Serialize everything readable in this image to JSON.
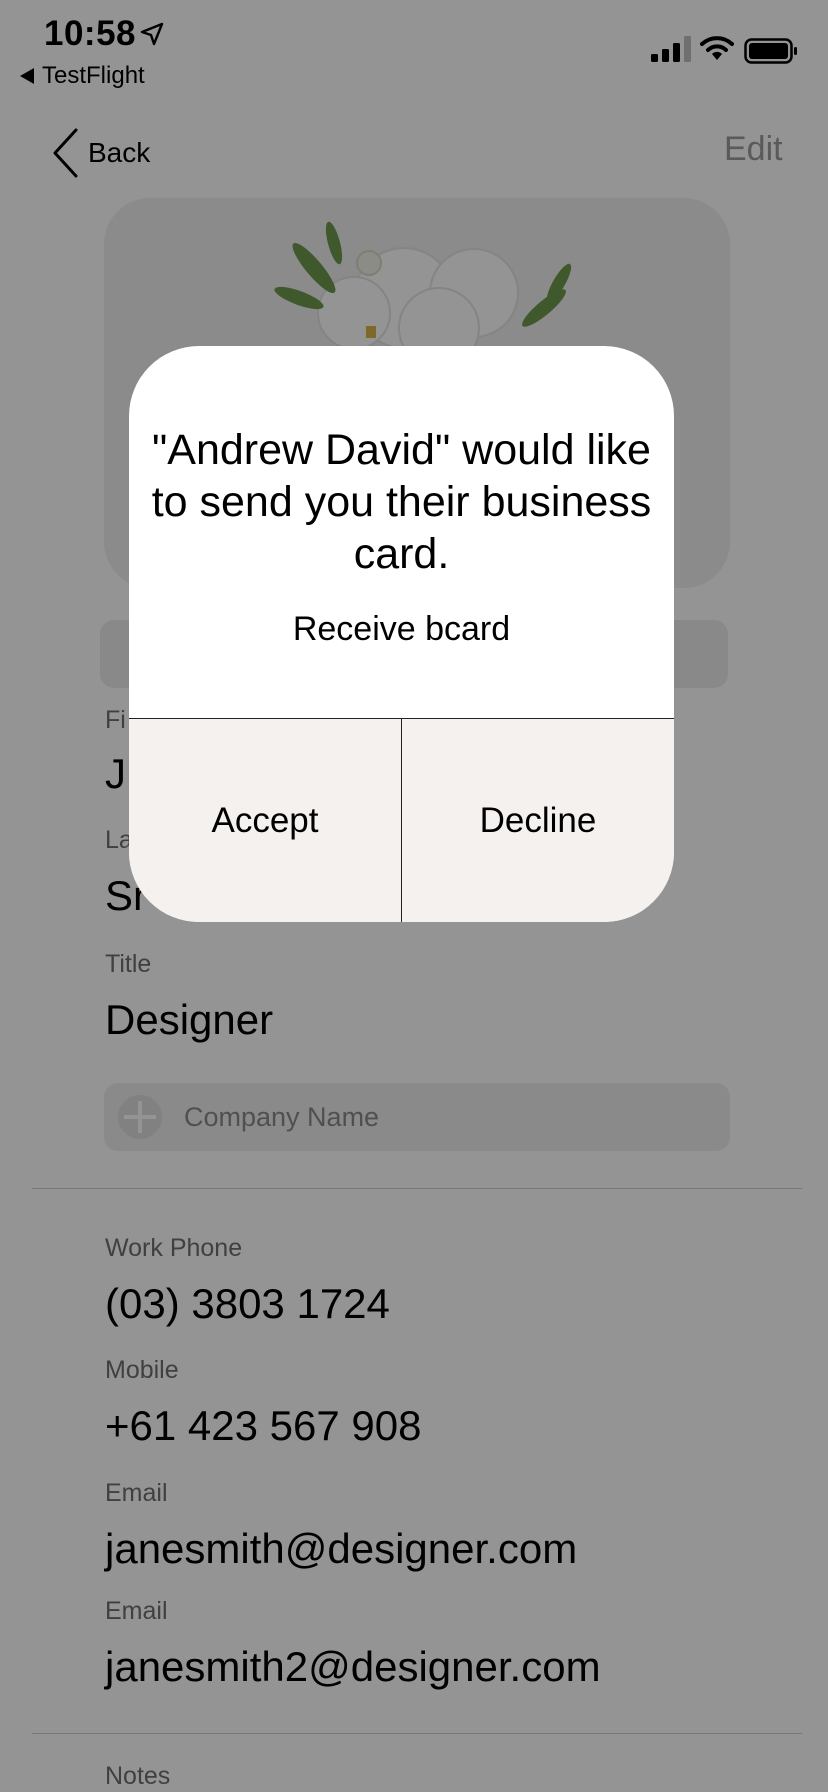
{
  "status_bar": {
    "time": "10:58",
    "back_app": "TestFlight",
    "icons": [
      "location-arrow-icon",
      "cellular-signal-icon",
      "wifi-icon",
      "battery-icon"
    ]
  },
  "nav": {
    "back_label": "Back",
    "edit_label": "Edit"
  },
  "form": {
    "title_label": "Title",
    "title_value": "Designer",
    "company_placeholder": "Company Name",
    "work_phone_label": "Work Phone",
    "work_phone_value": "(03) 3803 1724",
    "mobile_label": "Mobile",
    "mobile_value": "+61 423 567 908",
    "email1_label": "Email",
    "email1_value": "janesmith@designer.com",
    "email2_label": "Email",
    "email2_value": "janesmith2@designer.com",
    "notes_label": "Notes"
  },
  "dialog": {
    "title": "\"Andrew David\" would like to send you their business card.",
    "message": "Receive bcard",
    "accept_label": "Accept",
    "decline_label": "Decline"
  }
}
